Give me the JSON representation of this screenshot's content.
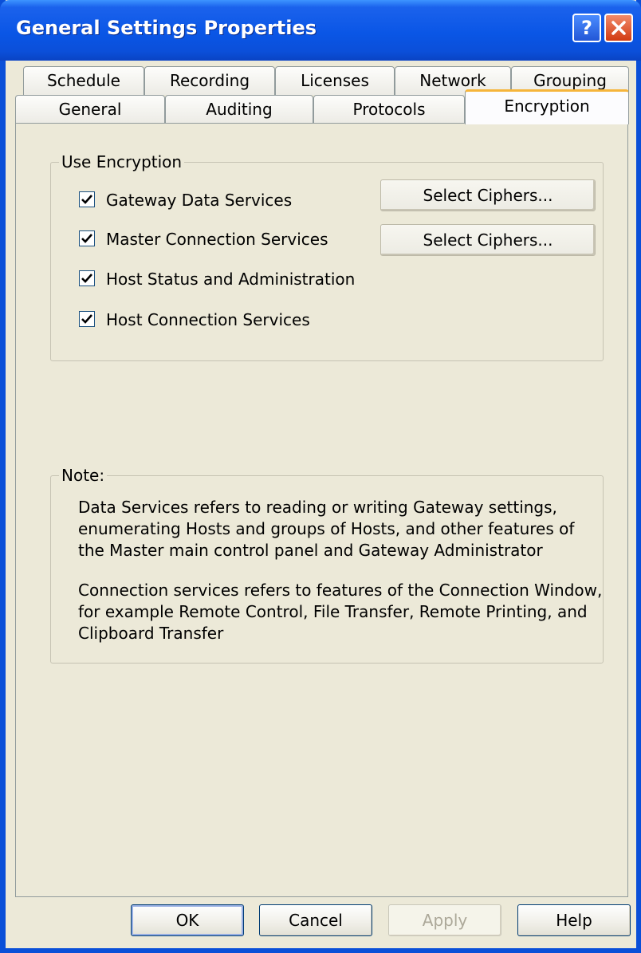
{
  "window": {
    "title": "General Settings Properties"
  },
  "tabs": {
    "row1": [
      "Schedule",
      "Recording",
      "Licenses",
      "Network",
      "Grouping"
    ],
    "row2": [
      "General",
      "Auditing",
      "Protocols",
      "Encryption"
    ],
    "active": "Encryption"
  },
  "encryption": {
    "group_label": "Use Encryption",
    "options": [
      {
        "label": "Gateway Data Services",
        "checked": true
      },
      {
        "label": "Master Connection Services",
        "checked": true
      },
      {
        "label": "Host Status and Administration",
        "checked": true
      },
      {
        "label": "Host Connection Services",
        "checked": true
      }
    ],
    "cipher_buttons": [
      "Select Ciphers...",
      "Select Ciphers..."
    ]
  },
  "note": {
    "label": "Note:",
    "para1": "Data Services refers to reading or writing Gateway settings, enumerating Hosts and groups of Hosts, and other features of the Master main control panel and Gateway Administrator",
    "para2": "Connection services refers to features of the Connection Window, for example Remote Control, File Transfer, Remote Printing, and Clipboard Transfer"
  },
  "buttons": {
    "ok": "OK",
    "cancel": "Cancel",
    "apply": "Apply",
    "help": "Help"
  },
  "colors": {
    "titlebar": "#0a56e6",
    "dialog_bg": "#ece9d8",
    "active_tab_accent": "#f6b53b"
  }
}
